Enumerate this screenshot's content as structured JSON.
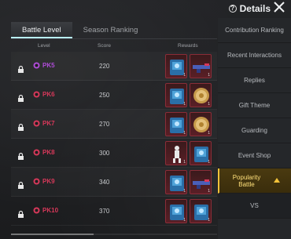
{
  "header": {
    "details_label": "Details"
  },
  "tabs": [
    {
      "label": "Battle Level",
      "active": true
    },
    {
      "label": "Season Ranking",
      "active": false
    }
  ],
  "columns": {
    "level": "Level",
    "score": "Score",
    "rewards": "Rewards"
  },
  "rows": [
    {
      "level": "PK5",
      "score": "220",
      "rewards": [
        {
          "icon": "blue-skin-crate-icon",
          "qty": "1"
        },
        {
          "icon": "weapon-skin-icon",
          "qty": "1"
        }
      ],
      "level_color": "#b04cd8"
    },
    {
      "level": "PK6",
      "score": "250",
      "rewards": [
        {
          "icon": "blue-skin-crate-icon",
          "qty": "1"
        },
        {
          "icon": "gold-coin-icon",
          "qty": "1"
        }
      ],
      "level_color": "#d8385a"
    },
    {
      "level": "PK7",
      "score": "270",
      "rewards": [
        {
          "icon": "blue-skin-crate-icon",
          "qty": "1"
        },
        {
          "icon": "gold-coin-icon",
          "qty": "1"
        }
      ],
      "level_color": "#d8385a"
    },
    {
      "level": "PK8",
      "score": "300",
      "rewards": [
        {
          "icon": "emote-figure-icon",
          "qty": "1"
        },
        {
          "icon": "blue-skin-crate-icon",
          "qty": "1"
        }
      ],
      "level_color": "#d8385a"
    },
    {
      "level": "PK9",
      "score": "340",
      "rewards": [
        {
          "icon": "blue-skin-crate-icon",
          "qty": "1"
        },
        {
          "icon": "weapon-skin-icon",
          "qty": "1"
        }
      ],
      "level_color": "#d8385a"
    },
    {
      "level": "PK10",
      "score": "370",
      "rewards": [
        {
          "icon": "blue-skin-crate-icon",
          "qty": "1"
        },
        {
          "icon": "blue-character-card-icon",
          "qty": "1"
        }
      ],
      "level_color": "#d8385a"
    }
  ],
  "sidebar": {
    "items": [
      {
        "label": "Contribution Ranking"
      },
      {
        "label": "Recent Interactions"
      },
      {
        "label": "Replies"
      },
      {
        "label": "Gift Theme"
      },
      {
        "label": "Guarding"
      },
      {
        "label": "Event Shop"
      },
      {
        "label": "Popularity Battle"
      },
      {
        "label": "VS"
      }
    ]
  },
  "colors": {
    "accent_gold": "#f2c23a",
    "level_red": "#d8385a",
    "level_purple": "#b04cd8"
  }
}
